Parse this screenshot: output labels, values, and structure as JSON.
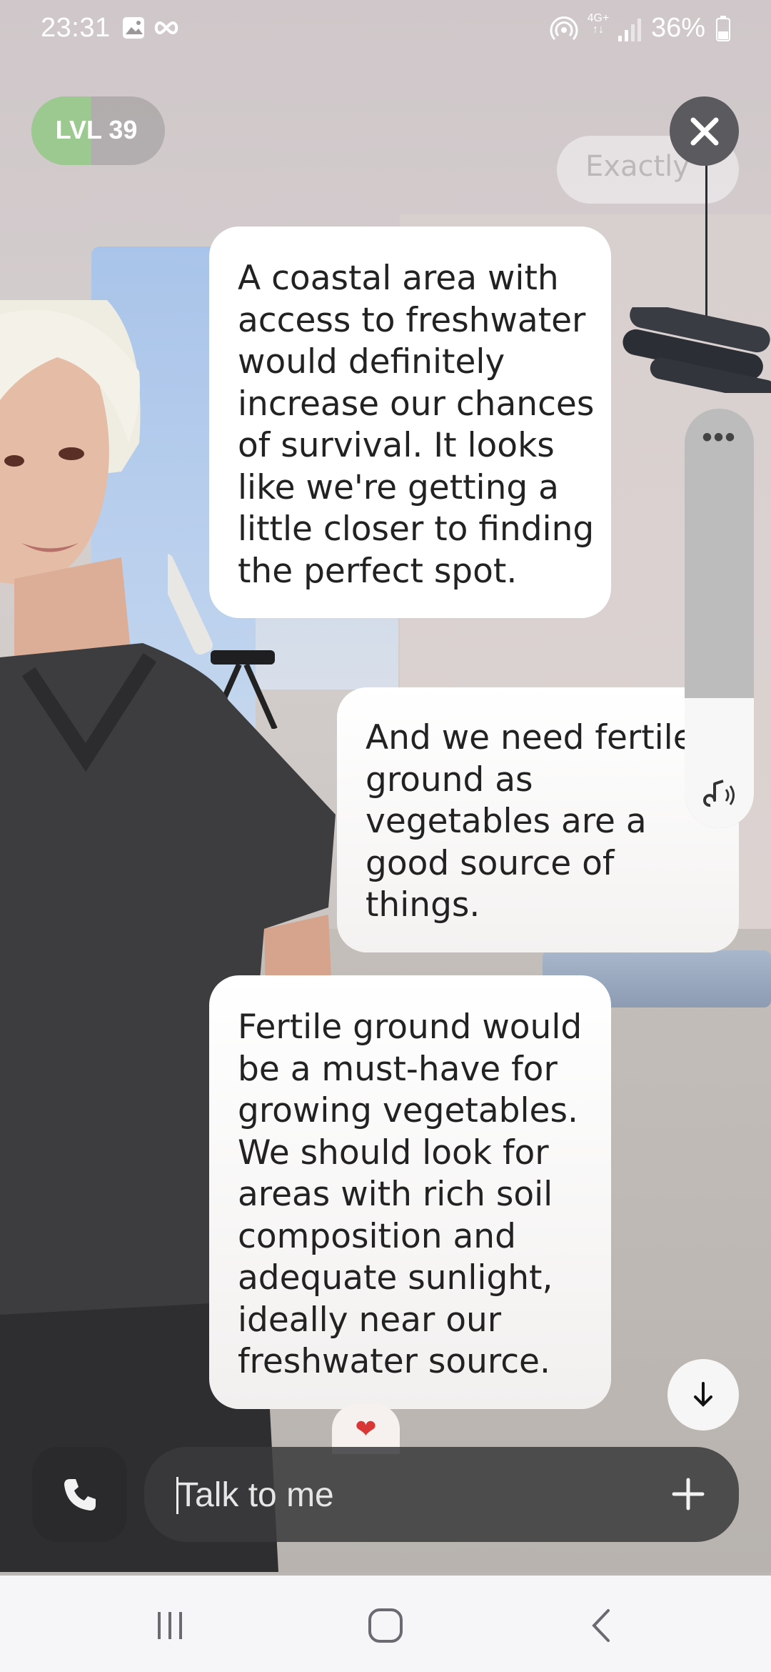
{
  "status_bar": {
    "time": "23:31",
    "battery": "36%",
    "network": "4G+",
    "icons": [
      "gallery-icon",
      "infinity-icon",
      "hotspot-icon",
      "network-4g-icon",
      "signal-icon",
      "battery-icon"
    ]
  },
  "level": {
    "label": "LVL 39",
    "progress": 0.45,
    "color": "#9bc98f"
  },
  "volume": {
    "level": 0.31
  },
  "ceiling_pill_text": "Exactly",
  "messages": [
    {
      "sender": "ai",
      "text": "A coastal area with access to freshwater would definitely increase our chances of survival. It looks like we're getting a little closer to finding the perfect spot."
    },
    {
      "sender": "user",
      "text": "And we need fertile ground as vegetables are a good source of things."
    },
    {
      "sender": "ai",
      "text": "Fertile ground would be a must-have for growing vegetables. We should look for areas with rich soil composition and adequate sunlight, ideally near our freshwater source."
    }
  ],
  "reaction": "❤",
  "input": {
    "placeholder": "Talk to me",
    "value": ""
  },
  "colors": {
    "bubble": "#ffffff",
    "input_bg": "#3a3a3c",
    "close_bg": "#5b5b5f",
    "heart": "#d93636"
  }
}
